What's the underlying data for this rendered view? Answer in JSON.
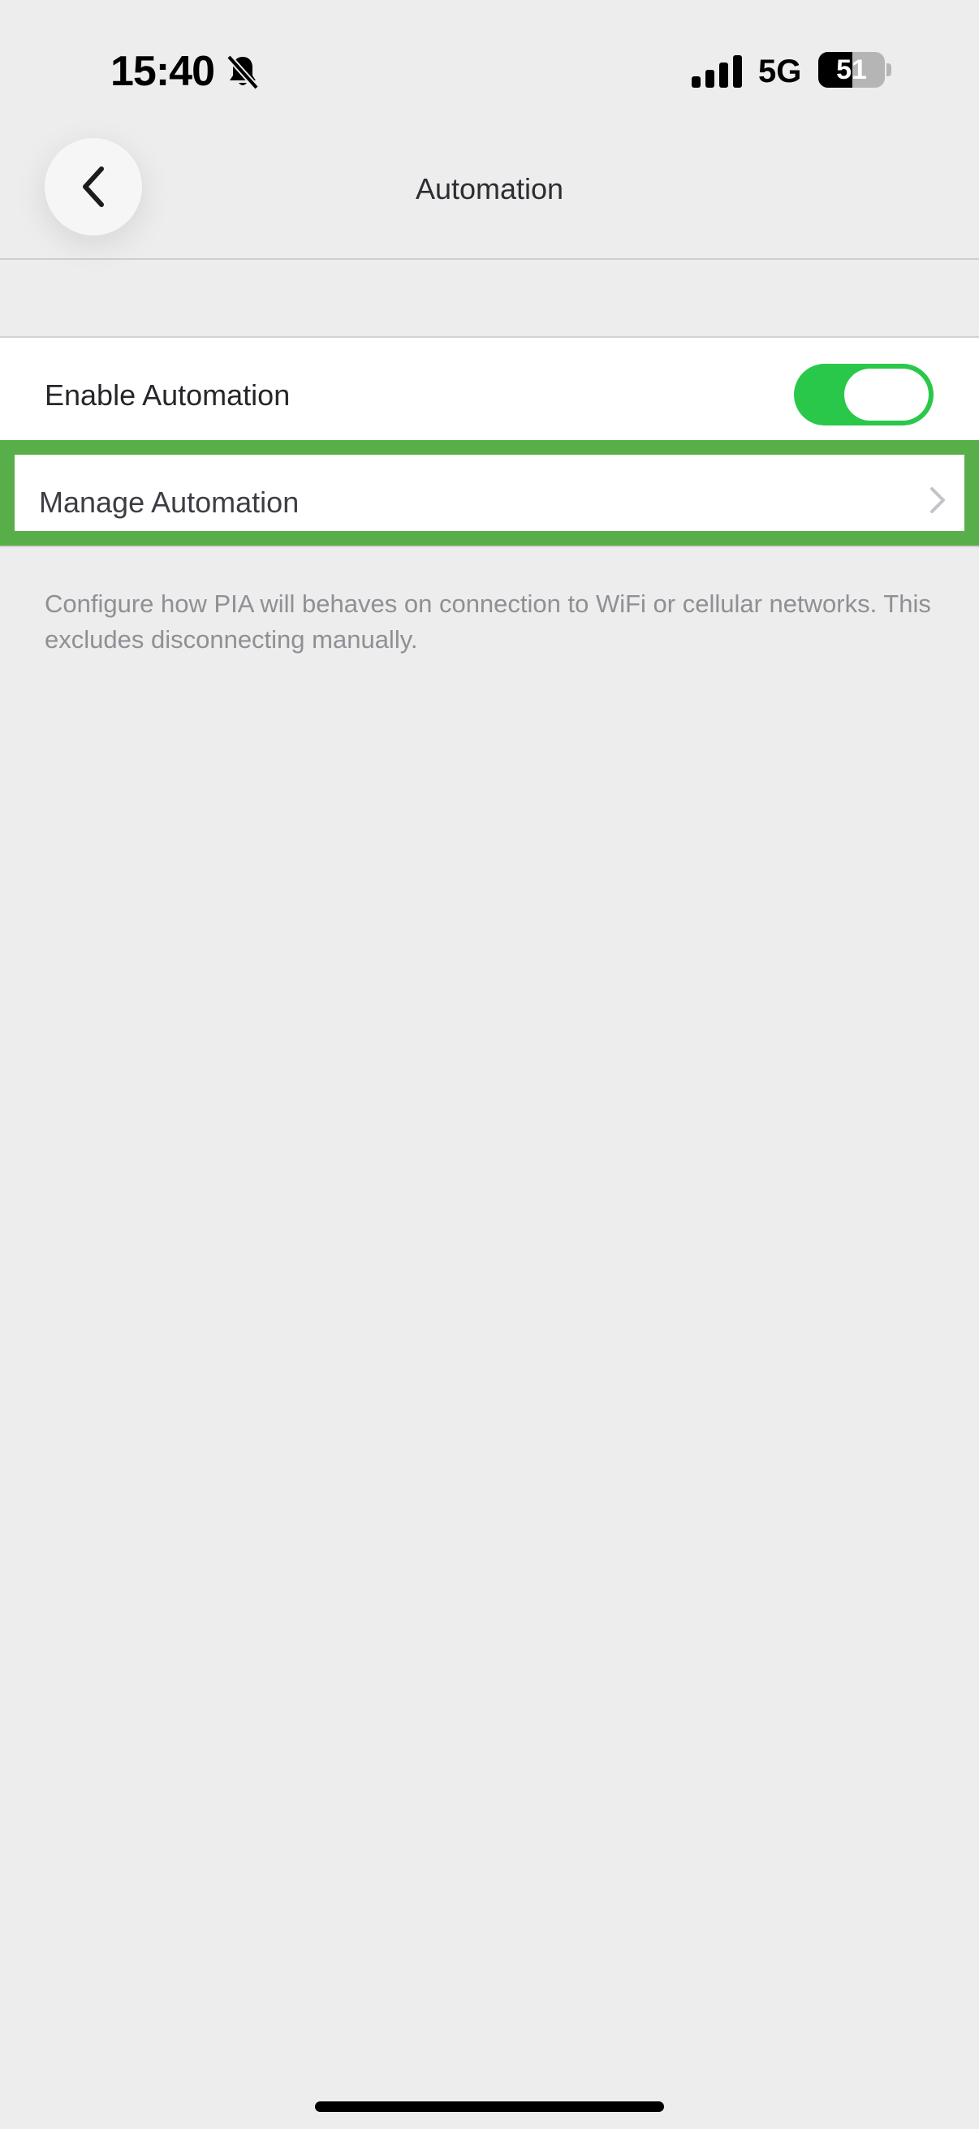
{
  "status_bar": {
    "time": "15:40",
    "network": "5G",
    "battery": "51",
    "battery_level": 0.51,
    "icons": [
      "bell-slash-icon",
      "cellular-signal-icon",
      "battery-icon"
    ]
  },
  "nav": {
    "title": "Automation",
    "back_icon": "chevron-left-icon"
  },
  "settings": {
    "enable_label": "Enable Automation",
    "enable_on": true,
    "manage_label": "Manage Automation",
    "manage_icon": "chevron-right-icon",
    "highlight_color": "#58ae49",
    "toggle_color": "#2ac84a"
  },
  "footnote": "Configure how PIA will behaves on connection to WiFi or cellular networks. This excludes disconnecting manually."
}
